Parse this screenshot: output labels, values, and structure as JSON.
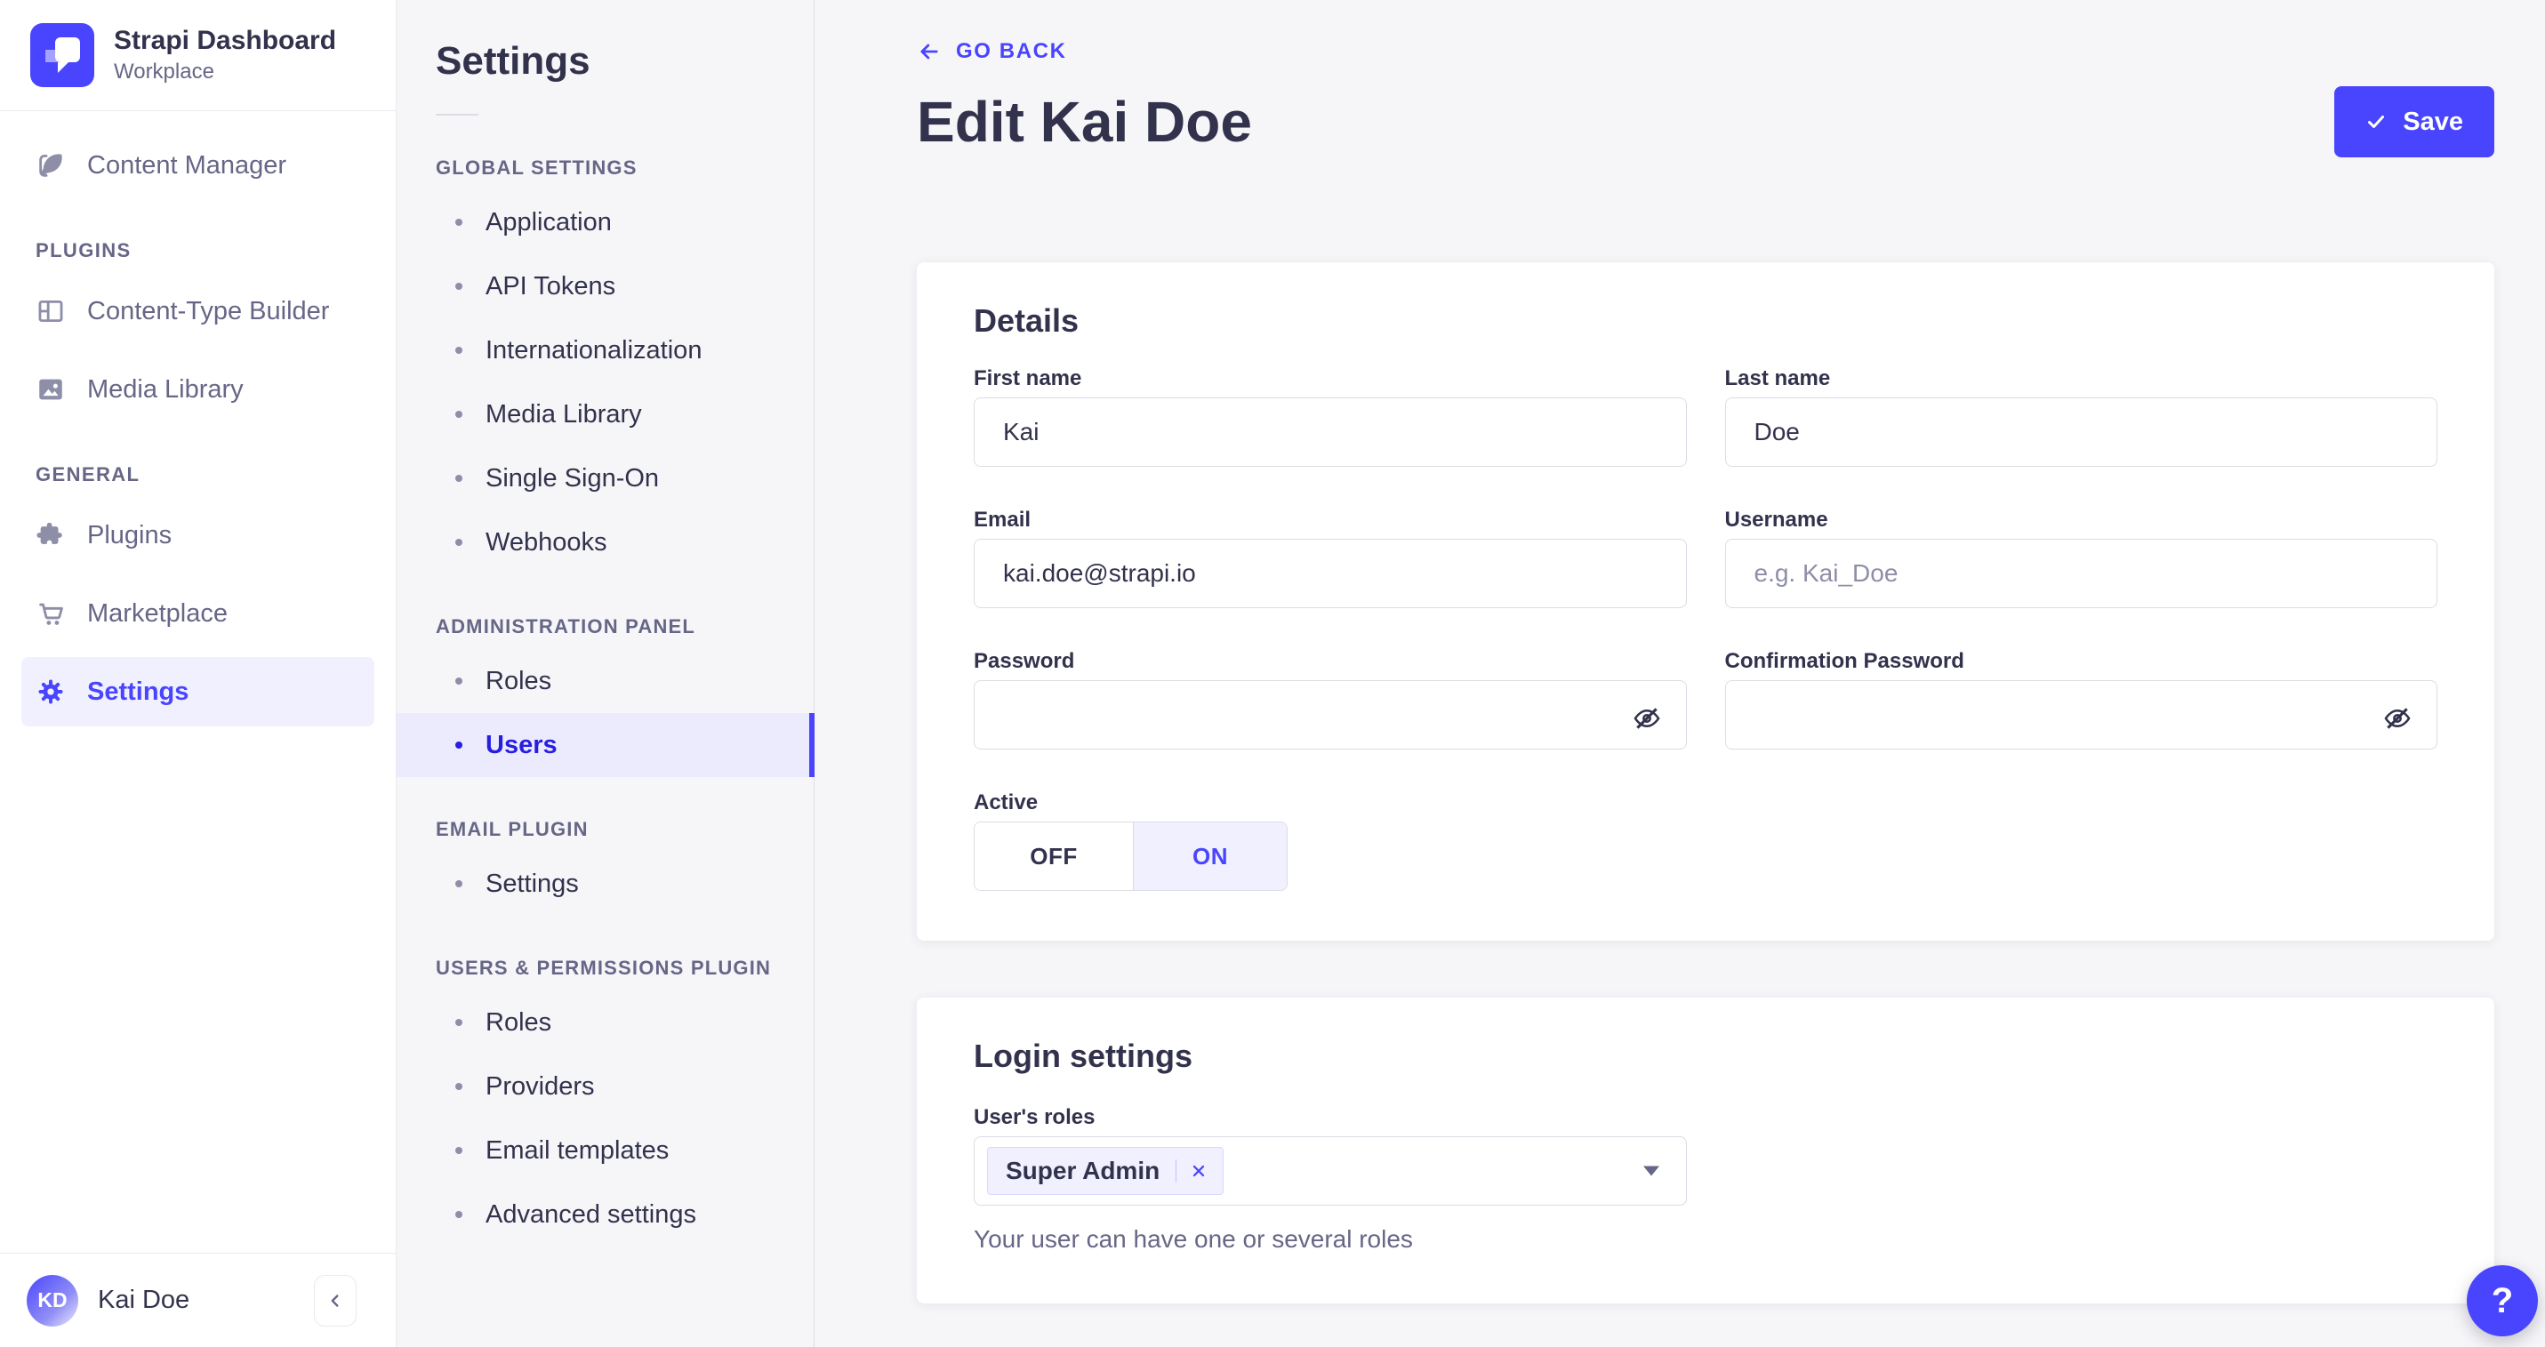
{
  "app": {
    "name": "Strapi Dashboard",
    "workspace": "Workplace"
  },
  "colors": {
    "accent": "#4945ff",
    "accent_dark": "#271fe0",
    "accent_light": "#f0f0ff",
    "background": "#f6f6f9",
    "text": "#32324d",
    "text_muted": "#666687",
    "border": "#dcdce4"
  },
  "icons": {
    "logo": "strapi-mark",
    "content_manager": "feather-pen",
    "content_type_builder": "layout-grid",
    "media_library": "image-picture",
    "plugins": "puzzle-piece",
    "marketplace": "shopping-cart",
    "settings": "gear",
    "back": "arrow-left",
    "save": "check",
    "password_visibility": "eye-off",
    "role_remove": "x-cross",
    "roles_dropdown": "caret-down",
    "collapse": "chevron-left",
    "help": "question-mark"
  },
  "sidebar": {
    "main_item": {
      "label": "Content Manager"
    },
    "sections": [
      {
        "title": "PLUGINS",
        "items": [
          {
            "label": "Content-Type Builder"
          },
          {
            "label": "Media Library"
          }
        ]
      },
      {
        "title": "GENERAL",
        "items": [
          {
            "label": "Plugins"
          },
          {
            "label": "Marketplace"
          },
          {
            "label": "Settings"
          }
        ]
      }
    ],
    "active_item": "Settings",
    "user": {
      "initials": "KD",
      "name": "Kai Doe"
    }
  },
  "subnav": {
    "title": "Settings",
    "groups": [
      {
        "title": "GLOBAL SETTINGS",
        "items": [
          "Application",
          "API Tokens",
          "Internationalization",
          "Media Library",
          "Single Sign-On",
          "Webhooks"
        ]
      },
      {
        "title": "ADMINISTRATION PANEL",
        "items": [
          "Roles",
          "Users"
        ]
      },
      {
        "title": "EMAIL PLUGIN",
        "items": [
          "Settings"
        ]
      },
      {
        "title": "USERS & PERMISSIONS PLUGIN",
        "items": [
          "Roles",
          "Providers",
          "Email templates",
          "Advanced settings"
        ]
      }
    ],
    "active_item": "Users"
  },
  "header": {
    "back_label": "GO BACK",
    "title": "Edit Kai Doe",
    "save_label": "Save"
  },
  "details": {
    "title": "Details",
    "first_name": {
      "label": "First name",
      "value": "Kai"
    },
    "last_name": {
      "label": "Last name",
      "value": "Doe"
    },
    "email": {
      "label": "Email",
      "value": "kai.doe@strapi.io"
    },
    "username": {
      "label": "Username",
      "value": "",
      "placeholder": "e.g. Kai_Doe"
    },
    "password": {
      "label": "Password",
      "value": ""
    },
    "confirmation_password": {
      "label": "Confirmation Password",
      "value": ""
    },
    "active": {
      "label": "Active",
      "off_label": "OFF",
      "on_label": "ON",
      "value": "ON"
    }
  },
  "login": {
    "title": "Login settings",
    "roles_label": "User's roles",
    "roles": [
      {
        "name": "Super Admin"
      }
    ],
    "helper": "Your user can have one or several roles"
  },
  "help_button": {
    "label": "?"
  }
}
